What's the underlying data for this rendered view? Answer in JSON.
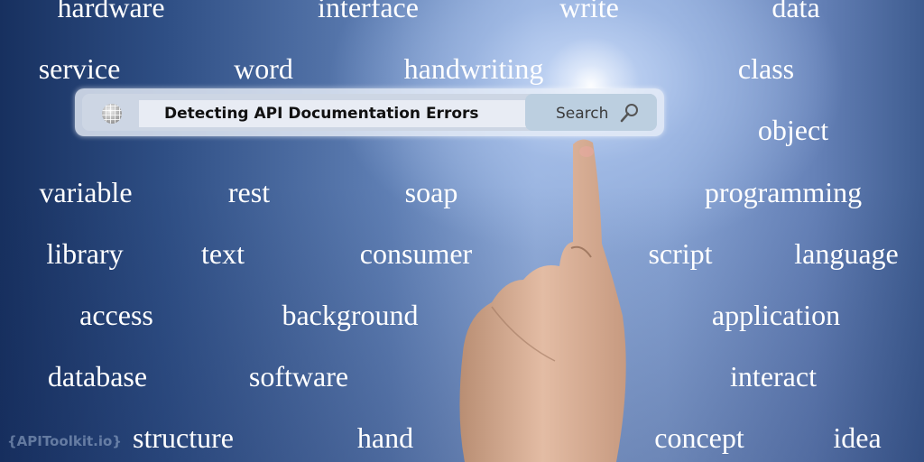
{
  "search": {
    "query": "Detecting API Documentation Errors",
    "button_label": "Search",
    "globe_icon": "globe-icon",
    "search_icon": "magnifier-icon"
  },
  "words": [
    "hardware",
    "interface",
    "write",
    "data",
    "service",
    "word",
    "handwriting",
    "class",
    "object",
    "variable",
    "rest",
    "soap",
    "programming",
    "library",
    "text",
    "consumer",
    "script",
    "language",
    "access",
    "background",
    "application",
    "database",
    "software",
    "interact",
    "structure",
    "hand",
    "concept",
    "idea"
  ],
  "branding": {
    "watermark": "{APIToolkit.io}"
  },
  "colors": {
    "bg_dark": "#17305f",
    "bg_light": "#a8c0ea",
    "word": "#ffffff",
    "search_button": "#bccfe0"
  }
}
